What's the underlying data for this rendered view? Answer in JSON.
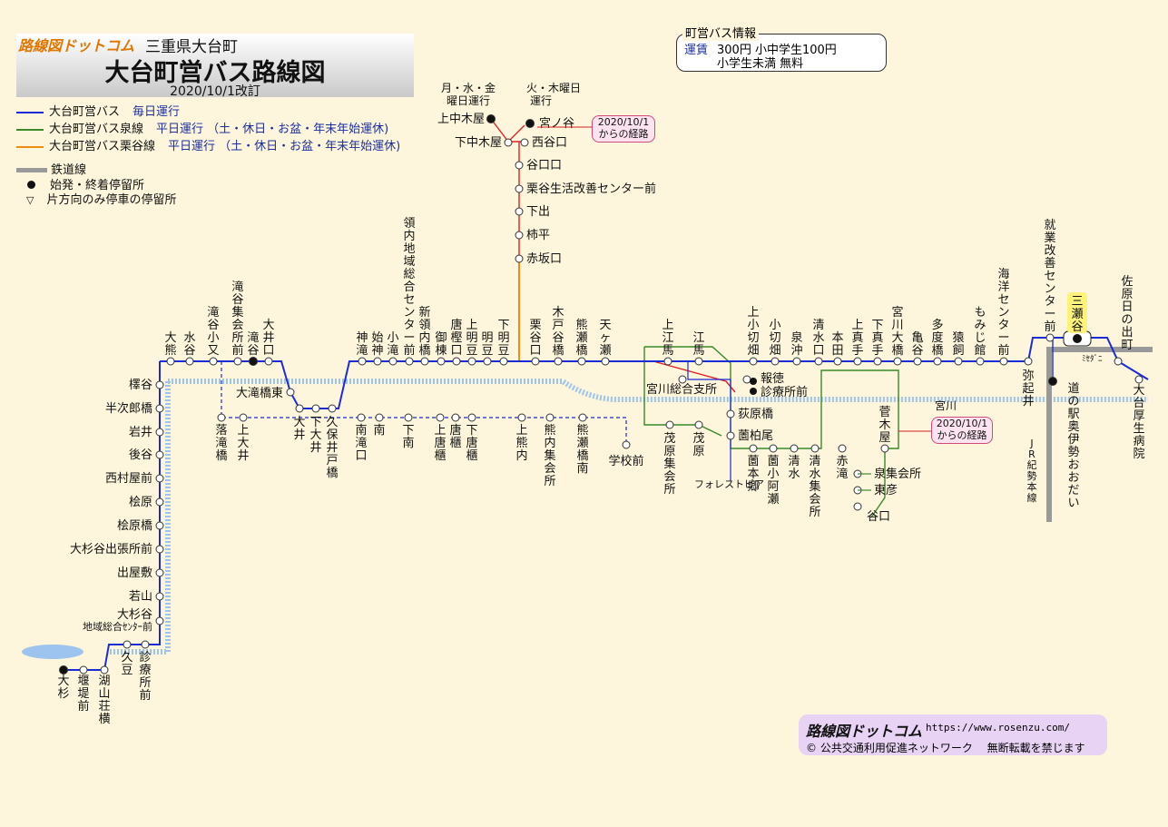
{
  "header": {
    "brand": "路線図ドットコム",
    "region": "三重県大台町",
    "title": "大台町営バス路線図",
    "revision": "2020/10/1改訂"
  },
  "legend": [
    {
      "label": "大台町営バス",
      "note": "毎日運行",
      "color": "#1b2bd8"
    },
    {
      "label": "大台町営バス泉線",
      "note": "平日運行 （土・休日・お盆・年末年始運休)",
      "color": "#3a8a2a"
    },
    {
      "label": "大台町営バス栗谷線",
      "note": "平日運行 （土・休日・お盆・年末年始運休)",
      "color": "#f08a10"
    }
  ],
  "legend_symbols": [
    {
      "label": "鉄道線",
      "icon": "railway-line-icon"
    },
    {
      "label": "始発・終着停留所",
      "icon": "terminal-stop-icon"
    },
    {
      "label": "片方向のみ停車の停留所",
      "icon": "one-way-stop-icon"
    }
  ],
  "fare_info": {
    "title": "町営バス情報",
    "key": "運賃",
    "line1": "300円 小中学生100円",
    "line2": "小学生未満 無料"
  },
  "callouts": [
    {
      "text": "2020/10/1\nからの経路"
    },
    {
      "text": "2020/10/1\nからの経路"
    }
  ],
  "schedule_labels": {
    "mon_wed_fri": "月・水・金\n曜日運行",
    "tue_thu": "火・木曜日\n運行"
  },
  "river_label": "宮川",
  "railway_label": "ＪＲ紀勢本線",
  "station_label": "三瀬谷",
  "station_sub": "ﾐｾﾀﾞﾆ",
  "footer": {
    "brand": "路線図ドットコム",
    "url": "https://www.rosenzu.com/",
    "copyright": "© 公共交通利用促進ネットワーク　 無断転載を禁じます"
  },
  "colors": {
    "main": "#1b2bd8",
    "izumi": "#3a8a2a",
    "kuritani": "#f08a10",
    "new_route": "#e02020",
    "rail": "#999999",
    "river": "#9dc4ee"
  },
  "stops": {
    "main_upper": [
      "大熊",
      "水谷",
      "滝谷小又",
      "滝谷集会所前",
      "滝谷",
      "大井口",
      "神滝",
      "始神",
      "小滝",
      "領内地域総合センター前",
      "新領内橋",
      "御棟",
      "唐樫口",
      "上明豆",
      "明豆",
      "下明豆",
      "栗谷口",
      "木戸谷橋",
      "熊瀬橋",
      "天ヶ瀬",
      "上江馬",
      "江馬",
      "上小切畑",
      "小切畑",
      "泉沖",
      "清水口",
      "本田",
      "上真手",
      "下真手",
      "宮川大橋",
      "亀谷",
      "多度橋",
      "猿飼",
      "もみじ館",
      "海洋センター前",
      "弥起井",
      "就業改善センター前",
      "三瀬谷",
      "佐原日の出町"
    ],
    "main_lower": [
      "落滝橋",
      "上大井",
      "大井",
      "下大井",
      "久保井戸橋",
      "南滝口",
      "南",
      "下南",
      "上唐櫃",
      "唐櫃",
      "下唐櫃",
      "上熊内",
      "熊内集会所",
      "熊瀬橋南",
      "学校前",
      "茂原集会所",
      "茂原",
      "フォレストピア"
    ],
    "west_branch": [
      "檡谷",
      "半次郎橋",
      "岩井",
      "後谷",
      "西村屋前",
      "桧原",
      "桧原橋",
      "大杉谷出張所前",
      "出屋敷",
      "若山",
      "大杉谷地域総合センター前",
      "大杉",
      "堰堤前",
      "久豆",
      "湖山荘横",
      "診療所前"
    ],
    "kuritani": [
      "上中木屋",
      "宮ノ谷",
      "下中木屋",
      "西谷口",
      "谷口口",
      "栗谷生活改善センター前",
      "下出",
      "柿平",
      "赤坂口"
    ],
    "izumi": [
      "宮川総合支所",
      "報徳",
      "診療所前",
      "荻原橋",
      "薗柏尾",
      "薗本郷",
      "薗小阿瀬",
      "清水",
      "清水集会所",
      "赤滝",
      "菅木屋",
      "泉集会所",
      "東彦",
      "谷口"
    ],
    "misc": [
      "大滝橋東",
      "道の駅奥伊勢おおだい",
      "大台厚生病院"
    ]
  }
}
